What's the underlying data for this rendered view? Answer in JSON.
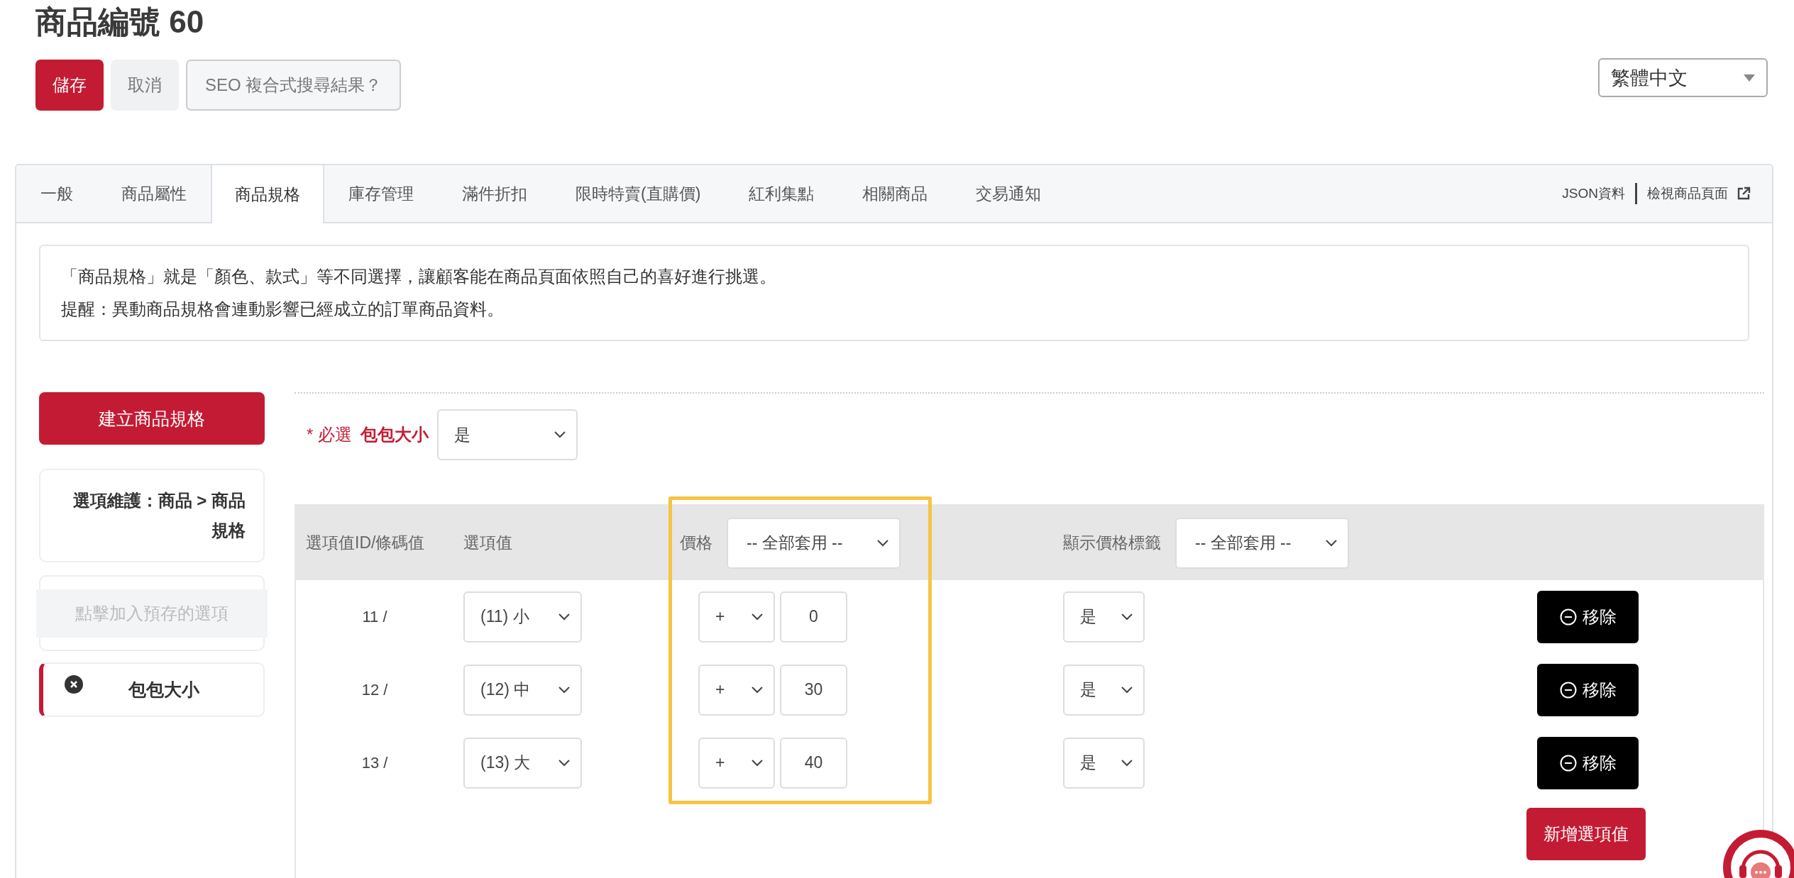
{
  "page_title": "商品編號 60",
  "actions": [
    {
      "label": "儲存",
      "kind": "primary"
    },
    {
      "label": "取消",
      "kind": "secondary"
    },
    {
      "label": "SEO 複合式搜尋結果？",
      "kind": "outline"
    }
  ],
  "language_select": {
    "value": "繁體中文"
  },
  "tabs": [
    {
      "label": "一般",
      "selected": false
    },
    {
      "label": "商品屬性",
      "selected": false
    },
    {
      "label": "商品規格",
      "selected": true
    },
    {
      "label": "庫存管理",
      "selected": false
    },
    {
      "label": "滿件折扣",
      "selected": false
    },
    {
      "label": "限時特賣(直購價)",
      "selected": false
    },
    {
      "label": "紅利集點",
      "selected": false
    },
    {
      "label": "相關商品",
      "selected": false
    },
    {
      "label": "交易通知",
      "selected": false
    }
  ],
  "tab_links": [
    {
      "label": "JSON資料",
      "external": false
    },
    {
      "label": "檢視商品頁面",
      "external": true
    }
  ],
  "notice": [
    "「商品規格」就是「顏色、款式」等不同選擇，讓顧客能在商品頁面依照自己的喜好進行挑選。",
    "提醒：異動商品規格會連動影響已經成立的訂單商品資料。"
  ],
  "sidebar": {
    "create_button": "建立商品規格",
    "breadcrumb": "選項維護：商品 > 商品規格",
    "preset_button": "點擊加入預存的選項",
    "specs": [
      {
        "name": "包包大小",
        "selected": true
      }
    ]
  },
  "spec_editor": {
    "required_mark": "* 必選",
    "spec_name": "包包大小",
    "required_select": "是",
    "columns": [
      {
        "label": "選項值ID/條碼值"
      },
      {
        "label": "選項值"
      },
      {
        "label": "價格",
        "apply_all": "-- 全部套用 --"
      },
      {
        "label": "顯示價格標籤",
        "apply_all": "-- 全部套用 --"
      }
    ],
    "rows": [
      {
        "id": "11 /",
        "option": "(11) 小",
        "sign": "+",
        "price": "0",
        "show_label": "是",
        "remove": "移除"
      },
      {
        "id": "12 /",
        "option": "(12) 中",
        "sign": "+",
        "price": "30",
        "show_label": "是",
        "remove": "移除"
      },
      {
        "id": "13 /",
        "option": "(13) 大",
        "sign": "+",
        "price": "40",
        "show_label": "是",
        "remove": "移除"
      }
    ],
    "add_button": "新增選項值"
  }
}
